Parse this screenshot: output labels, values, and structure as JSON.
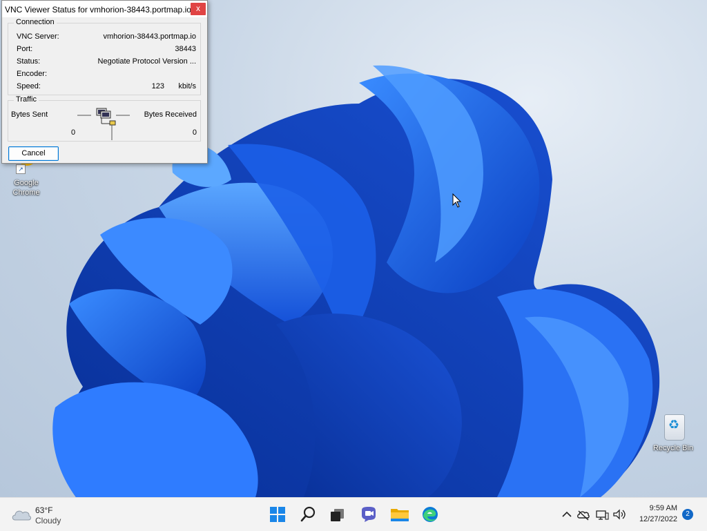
{
  "dialog": {
    "title": "VNC Viewer Status for vmhorion-38443.portmap.io",
    "close_label": "x",
    "connection": {
      "legend": "Connection",
      "server_label": "VNC Server:",
      "server_value": "vmhorion-38443.portmap.io",
      "port_label": "Port:",
      "port_value": "38443",
      "status_label": "Status:",
      "status_value": "Negotiate Protocol Version ...",
      "encoder_label": "Encoder:",
      "encoder_value": "",
      "speed_label": "Speed:",
      "speed_value": "123",
      "speed_unit": "kbit/s"
    },
    "traffic": {
      "legend": "Traffic",
      "sent_label": "Bytes Sent",
      "received_label": "Bytes Received",
      "sent_value": "0",
      "received_value": "0"
    },
    "cancel_label": "Cancel"
  },
  "desktop": {
    "icons": [
      {
        "label": "Google Chrome",
        "icon": "chrome-icon"
      },
      {
        "label": "Recycle Bin",
        "icon": "recycle-bin-icon"
      }
    ]
  },
  "taskbar": {
    "weather_temp": "63°F",
    "weather_condition": "Cloudy",
    "apps": [
      "start-icon",
      "search-icon",
      "task-view-icon",
      "chat-icon",
      "file-explorer-icon",
      "edge-icon"
    ],
    "clock_time": "9:59 AM",
    "clock_date": "12/27/2022",
    "notification_count": "2"
  },
  "colors": {
    "accent": "#0078d7",
    "close_button": "#e04343",
    "taskbar_bg": "#f3f3f3",
    "bloom_blue": "#1e64e6"
  }
}
